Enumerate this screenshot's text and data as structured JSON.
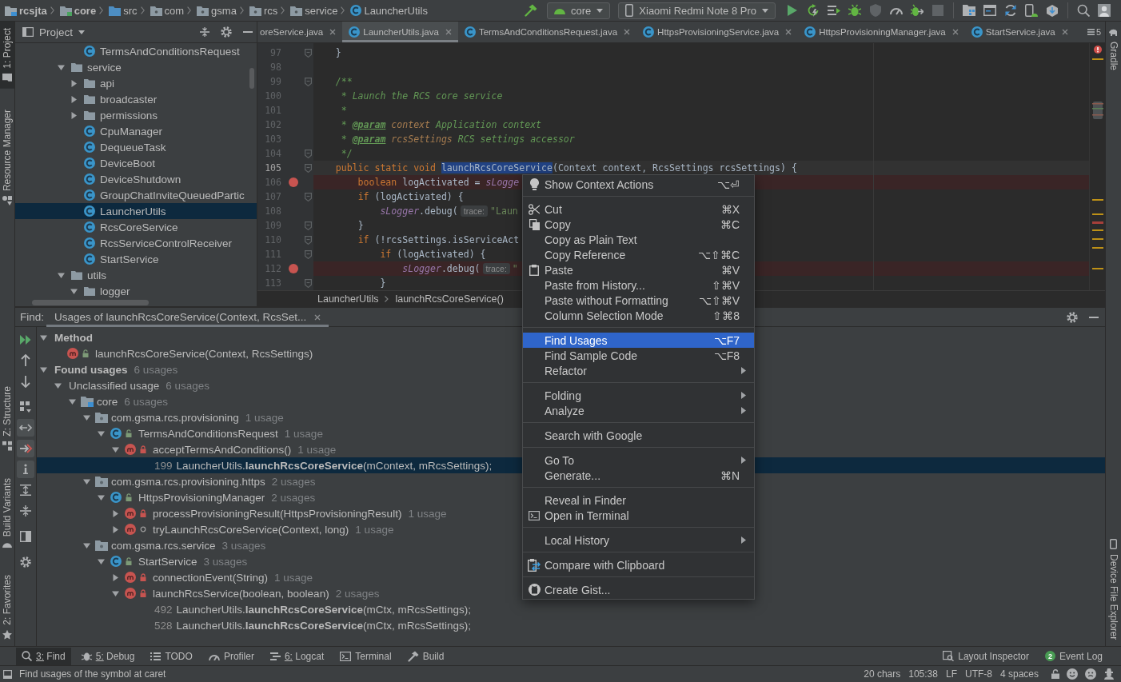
{
  "navbar": {
    "crumbs": [
      {
        "label": "rcsjta",
        "kind": "project"
      },
      {
        "label": "core",
        "kind": "module"
      },
      {
        "label": "src",
        "kind": "source_root"
      },
      {
        "label": "com",
        "kind": "package"
      },
      {
        "label": "gsma",
        "kind": "package"
      },
      {
        "label": "rcs",
        "kind": "package"
      },
      {
        "label": "service",
        "kind": "package"
      },
      {
        "label": "LauncherUtils",
        "kind": "class"
      }
    ],
    "run_config": "core",
    "device": "Xiaomi Redmi Note 8 Pro",
    "run_actions": [
      {
        "disabled": false
      },
      {
        "disabled": false
      },
      {
        "disabled": false
      },
      {
        "disabled": false
      },
      {
        "disabled": true
      },
      {
        "disabled": false
      },
      {
        "disabled": false
      },
      {
        "disabled": true
      }
    ]
  },
  "left_stripe": {
    "top": [
      {
        "label": "1: Project",
        "selected": true
      },
      {
        "label": "Resource Manager",
        "selected": false
      }
    ],
    "bottom": [
      {
        "label": "Z: Structure",
        "selected": false
      },
      {
        "label": "Build Variants",
        "selected": false
      },
      {
        "label": "2: Favorites",
        "selected": false
      }
    ]
  },
  "right_stripe": {
    "top": [
      {
        "label": "Gradle"
      }
    ],
    "bottom": [
      {
        "label": "Device File Explorer"
      }
    ]
  },
  "project_panel": {
    "title": "Project",
    "tree": {
      "items_under_offscreen_parent": [
        {
          "label": "TermsAndConditionsRequest",
          "kind": "class",
          "selected": false
        }
      ],
      "items": [
        {
          "label": "service",
          "kind": "folder",
          "expanded": true,
          "selected": false,
          "children": [
            {
              "label": "api",
              "kind": "folder",
              "expanded": false,
              "selected": false
            },
            {
              "label": "broadcaster",
              "kind": "folder",
              "expanded": false,
              "selected": false
            },
            {
              "label": "permissions",
              "kind": "folder",
              "expanded": false,
              "selected": false
            },
            {
              "label": "CpuManager",
              "kind": "class",
              "selected": false
            },
            {
              "label": "DequeueTask",
              "kind": "class",
              "selected": false
            },
            {
              "label": "DeviceBoot",
              "kind": "class",
              "selected": false
            },
            {
              "label": "DeviceShutdown",
              "kind": "class",
              "selected": false
            },
            {
              "label": "GroupChatInviteQueuedPartic",
              "kind": "class",
              "selected": false
            },
            {
              "label": "LauncherUtils",
              "kind": "class",
              "selected": true
            },
            {
              "label": "RcsCoreService",
              "kind": "class",
              "selected": false
            },
            {
              "label": "RcsServiceControlReceiver",
              "kind": "class",
              "selected": false
            },
            {
              "label": "StartService",
              "kind": "class",
              "selected": false
            }
          ]
        },
        {
          "label": "utils",
          "kind": "folder",
          "expanded": true,
          "selected": false,
          "children": [
            {
              "label": "logger",
              "kind": "folder",
              "expanded": true,
              "selected": false
            }
          ]
        }
      ]
    }
  },
  "editor": {
    "tabs": [
      {
        "label": "oreService.java",
        "kind": "clipped",
        "selected": false
      },
      {
        "label": "LauncherUtils.java",
        "kind": "file",
        "selected": true
      },
      {
        "label": "TermsAndConditionsRequest.java",
        "kind": "file",
        "selected": false
      },
      {
        "label": "HttpsProvisioningService.java",
        "kind": "file",
        "selected": false
      },
      {
        "label": "HttpsProvisioningManager.java",
        "kind": "file",
        "selected": false
      },
      {
        "label": "StartService.java",
        "kind": "file",
        "selected": false
      }
    ],
    "hidden_tabs_count": "5",
    "lines": [
      {
        "number": "97",
        "breakpoint": false,
        "fold": true,
        "current": false,
        "tokens": [
          {
            "text": "    }",
            "kind": "plain"
          }
        ]
      },
      {
        "number": "98",
        "breakpoint": false,
        "fold": false,
        "current": false
      },
      {
        "number": "99",
        "breakpoint": false,
        "fold": true,
        "current": false,
        "tokens": [
          {
            "text": "    /**",
            "kind": "doc"
          }
        ]
      },
      {
        "number": "100",
        "breakpoint": false,
        "fold": false,
        "current": false,
        "tokens": [
          {
            "text": "     * Launch the RCS core service",
            "kind": "doc"
          }
        ]
      },
      {
        "number": "101",
        "breakpoint": false,
        "fold": false,
        "current": false,
        "tokens": [
          {
            "text": "     *",
            "kind": "doc"
          }
        ]
      },
      {
        "number": "102",
        "breakpoint": false,
        "fold": false,
        "current": false,
        "tokens": [
          {
            "text": "     * ",
            "kind": "doc"
          },
          {
            "text": "@param",
            "kind": "doc_tag"
          },
          {
            "text": " context",
            "kind": "doc_param"
          },
          {
            "text": " Application context",
            "kind": "doc"
          }
        ]
      },
      {
        "number": "103",
        "breakpoint": false,
        "fold": false,
        "current": false,
        "tokens": [
          {
            "text": "     * ",
            "kind": "doc"
          },
          {
            "text": "@param",
            "kind": "doc_tag"
          },
          {
            "text": " rcsSettings",
            "kind": "doc_param"
          },
          {
            "text": " RCS settings accessor",
            "kind": "doc"
          }
        ]
      },
      {
        "number": "104",
        "breakpoint": false,
        "fold": true,
        "current": false,
        "tokens": [
          {
            "text": "     */",
            "kind": "doc"
          }
        ]
      },
      {
        "number": "105",
        "breakpoint": false,
        "fold": true,
        "current": true,
        "tokens": [
          {
            "text": "    public static void ",
            "kind": "keyword"
          },
          {
            "text": "launchRcsCoreService",
            "kind": "selection"
          },
          {
            "text": "(Context context, RcsSettings rcsSettings) {",
            "kind": "plain"
          }
        ]
      },
      {
        "number": "106",
        "breakpoint": true,
        "fold": false,
        "current": false,
        "tokens": [
          {
            "text": "        boolean",
            "kind": "keyword"
          },
          {
            "text": " logActivated = ",
            "kind": "plain"
          },
          {
            "text": "sLogge",
            "kind": "static_field"
          }
        ]
      },
      {
        "number": "107",
        "breakpoint": false,
        "fold": true,
        "current": false,
        "tokens": [
          {
            "text": "        if",
            "kind": "keyword"
          },
          {
            "text": " (logActivated) {",
            "kind": "plain"
          }
        ]
      },
      {
        "number": "108",
        "breakpoint": false,
        "fold": false,
        "current": false,
        "tokens": [
          {
            "text": "            sLogger",
            "kind": "static_field"
          },
          {
            "text": ".debug(",
            "kind": "plain"
          },
          {
            "text": "trace:",
            "kind": "hint"
          },
          {
            "text": "\"Laun",
            "kind": "string"
          }
        ]
      },
      {
        "number": "109",
        "breakpoint": false,
        "fold": true,
        "current": false,
        "tokens": [
          {
            "text": "        }",
            "kind": "plain"
          }
        ]
      },
      {
        "number": "110",
        "breakpoint": false,
        "fold": true,
        "current": false,
        "tokens": [
          {
            "text": "        if",
            "kind": "keyword"
          },
          {
            "text": " (!rcsSettings.isServiceAct",
            "kind": "plain"
          }
        ]
      },
      {
        "number": "111",
        "breakpoint": false,
        "fold": true,
        "current": false,
        "tokens": [
          {
            "text": "            if",
            "kind": "keyword"
          },
          {
            "text": " (logActivated) {",
            "kind": "plain"
          }
        ]
      },
      {
        "number": "112",
        "breakpoint": true,
        "fold": false,
        "current": false,
        "tokens": [
          {
            "text": "                sLogger",
            "kind": "static_field"
          },
          {
            "text": ".debug(",
            "kind": "plain"
          },
          {
            "text": "trace:",
            "kind": "hint"
          },
          {
            "text": "\"",
            "kind": "string"
          }
        ]
      },
      {
        "number": "113",
        "breakpoint": false,
        "fold": true,
        "current": false,
        "tokens": [
          {
            "text": "            }",
            "kind": "plain"
          }
        ]
      }
    ],
    "breadcrumb": [
      "LauncherUtils",
      "launchRcsCoreService()"
    ]
  },
  "find_panel": {
    "label": "Find:",
    "tabs": [
      {
        "label": "Usages of launchRcsCoreService(Context, RcsSet...",
        "selected": true
      }
    ],
    "toolbar": [
      {
        "on": false
      },
      {
        "on": false
      },
      {
        "on": false
      },
      {
        "on": false
      },
      {
        "on": true
      },
      {
        "on": true
      },
      {
        "on": true
      },
      {
        "on": false
      },
      {
        "on": false
      },
      {
        "on": false
      },
      {
        "on": false
      }
    ],
    "tree": [
      {
        "label": "Method",
        "kind": "group",
        "expanded": true,
        "selected": false,
        "children": [
          {
            "label": "launchRcsCoreService(Context, RcsSettings)",
            "kind": "public_method",
            "selected": false
          }
        ]
      },
      {
        "label": "Found usages",
        "kind": "group",
        "count": "6 usages",
        "expanded": true,
        "selected": false,
        "children": [
          {
            "label": "Unclassified usage",
            "kind": "category",
            "count": "6 usages",
            "expanded": true,
            "selected": false,
            "children": [
              {
                "label": "core",
                "kind": "module",
                "count": "6 usages",
                "expanded": true,
                "selected": false,
                "children": [
                  {
                    "label": "com.gsma.rcs.provisioning",
                    "kind": "package",
                    "count": "1 usage",
                    "expanded": true,
                    "selected": false,
                    "children": [
                      {
                        "label": "TermsAndConditionsRequest",
                        "kind": "public_class",
                        "count": "1 usage",
                        "expanded": true,
                        "selected": false,
                        "children": [
                          {
                            "label": "acceptTermsAndConditions()",
                            "kind": "private_method",
                            "count": "1 usage",
                            "expanded": true,
                            "selected": false,
                            "children": [
                              {
                                "line": "199",
                                "label": "LauncherUtils.**launchRcsCoreService**(mContext, mRcsSettings);",
                                "kind": "usage",
                                "selected": true
                              }
                            ]
                          }
                        ]
                      }
                    ]
                  },
                  {
                    "label": "com.gsma.rcs.provisioning.https",
                    "kind": "package",
                    "count": "2 usages",
                    "expanded": true,
                    "selected": false,
                    "children": [
                      {
                        "label": "HttpsProvisioningManager",
                        "kind": "public_class",
                        "count": "2 usages",
                        "expanded": true,
                        "selected": false,
                        "children": [
                          {
                            "label": "processProvisioningResult(HttpsProvisioningResult)",
                            "kind": "private_method",
                            "count": "1 usage",
                            "expanded": false,
                            "selected": false
                          },
                          {
                            "label": "tryLaunchRcsCoreService(Context, long)",
                            "kind": "package_method",
                            "count": "1 usage",
                            "expanded": false,
                            "selected": false
                          }
                        ]
                      }
                    ]
                  },
                  {
                    "label": "com.gsma.rcs.service",
                    "kind": "package",
                    "count": "3 usages",
                    "expanded": true,
                    "selected": false,
                    "children": [
                      {
                        "label": "StartService",
                        "kind": "public_class",
                        "count": "3 usages",
                        "expanded": true,
                        "selected": false,
                        "children": [
                          {
                            "label": "connectionEvent(String)",
                            "kind": "private_method",
                            "count": "1 usage",
                            "expanded": false,
                            "selected": false
                          },
                          {
                            "label": "launchRcsService(boolean, boolean)",
                            "kind": "private_method",
                            "count": "2 usages",
                            "expanded": true,
                            "selected": false,
                            "children": [
                              {
                                "line": "492",
                                "label": "LauncherUtils.**launchRcsCoreService**(mCtx, mRcsSettings);",
                                "kind": "usage",
                                "selected": false
                              },
                              {
                                "line": "528",
                                "label": "LauncherUtils.**launchRcsCoreService**(mCtx, mRcsSettings);",
                                "kind": "usage",
                                "selected": false
                              }
                            ]
                          }
                        ]
                      }
                    ]
                  }
                ]
              }
            ]
          }
        ]
      }
    ]
  },
  "context_menu": {
    "groups": [
      {
        "items": [
          {
            "label": "Show Context Actions",
            "shortcut": "⌥⏎",
            "submenu": false,
            "selected": false
          }
        ]
      },
      {
        "items": [
          {
            "label": "Cut",
            "shortcut": "⌘X",
            "submenu": false,
            "selected": false
          },
          {
            "label": "Copy",
            "shortcut": "⌘C",
            "submenu": false,
            "selected": false
          },
          {
            "label": "Copy as Plain Text",
            "submenu": false,
            "selected": false
          },
          {
            "label": "Copy Reference",
            "shortcut": "⌥⇧⌘C",
            "submenu": false,
            "selected": false
          },
          {
            "label": "Paste",
            "shortcut": "⌘V",
            "submenu": false,
            "selected": false
          },
          {
            "label": "Paste from History...",
            "shortcut": "⇧⌘V",
            "submenu": false,
            "selected": false
          },
          {
            "label": "Paste without Formatting",
            "shortcut": "⌥⇧⌘V",
            "submenu": false,
            "selected": false
          },
          {
            "label": "Column Selection Mode",
            "shortcut": "⇧⌘8",
            "submenu": false,
            "selected": false
          }
        ]
      },
      {
        "items": [
          {
            "label": "Find Usages",
            "shortcut": "⌥F7",
            "submenu": false,
            "selected": true
          },
          {
            "label": "Find Sample Code",
            "shortcut": "⌥F8",
            "submenu": false,
            "selected": false
          },
          {
            "label": "Refactor",
            "submenu": true,
            "selected": false
          }
        ]
      },
      {
        "items": [
          {
            "label": "Folding",
            "submenu": true,
            "selected": false
          },
          {
            "label": "Analyze",
            "submenu": true,
            "selected": false
          }
        ]
      },
      {
        "items": [
          {
            "label": "Search with Google",
            "submenu": false,
            "selected": false
          }
        ]
      },
      {
        "items": [
          {
            "label": "Go To",
            "submenu": true,
            "selected": false
          },
          {
            "label": "Generate...",
            "shortcut": "⌘N",
            "submenu": false,
            "selected": false
          }
        ]
      },
      {
        "items": [
          {
            "label": "Reveal in Finder",
            "submenu": false,
            "selected": false
          },
          {
            "label": "Open in Terminal",
            "submenu": false,
            "selected": false
          }
        ]
      },
      {
        "items": [
          {
            "label": "Local History",
            "submenu": true,
            "selected": false
          }
        ]
      },
      {
        "items": [
          {
            "label": "Compare with Clipboard",
            "submenu": false,
            "selected": false
          }
        ]
      },
      {
        "items": [
          {
            "label": "Create Gist...",
            "submenu": false,
            "selected": false
          }
        ]
      }
    ]
  },
  "tool_windows": {
    "left": [
      {
        "label": "3: Find",
        "mnemonic": true,
        "selected": true
      },
      {
        "label": "5: Debug",
        "mnemonic": true,
        "selected": false
      },
      {
        "label": "TODO",
        "mnemonic": false,
        "selected": false
      },
      {
        "label": "Profiler",
        "mnemonic": false,
        "selected": false
      },
      {
        "label": "6: Logcat",
        "mnemonic": true,
        "selected": false
      },
      {
        "label": "Terminal",
        "mnemonic": false,
        "selected": false
      },
      {
        "label": "Build",
        "mnemonic": false,
        "selected": false
      }
    ],
    "right": [
      {
        "label": "Layout Inspector",
        "selected": false
      },
      {
        "label": "Event Log",
        "badge": "2",
        "selected": false
      }
    ]
  },
  "status_bar": {
    "message": "Find usages of the symbol at caret",
    "widgets": [
      "20 chars",
      "105:38",
      "LF",
      "UTF-8",
      "4 spaces"
    ]
  }
}
